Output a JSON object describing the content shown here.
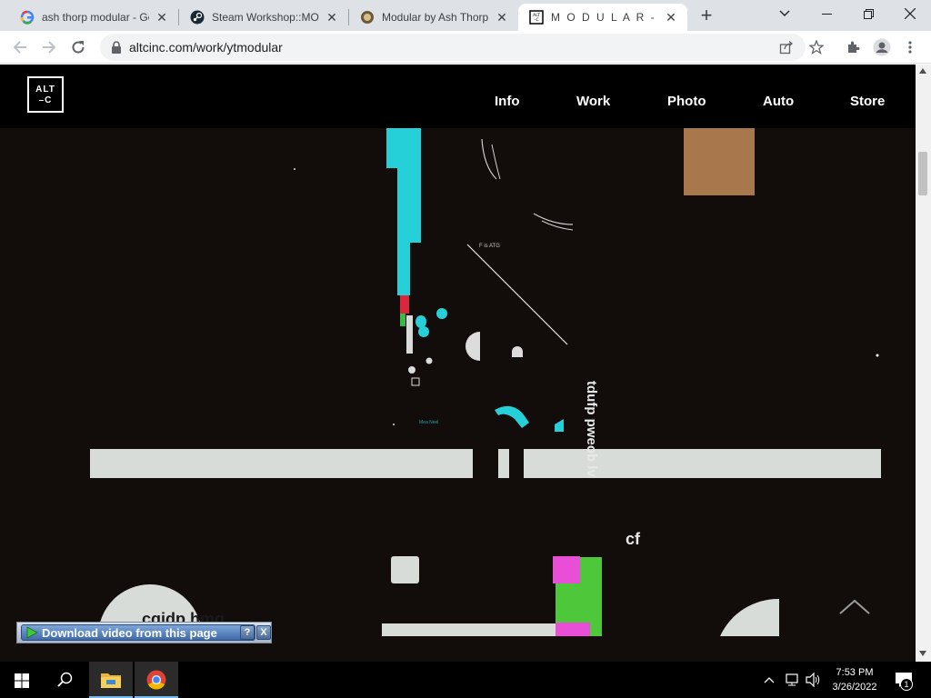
{
  "browser": {
    "tabs": [
      {
        "title": "ash thorp modular - Go",
        "icon": "google-icon"
      },
      {
        "title": "Steam Workshop::MOD",
        "icon": "steam-icon"
      },
      {
        "title": "Modular by Ash Thorp",
        "icon": "modular-favicon"
      },
      {
        "title": "M O D U L A R - Ash Th",
        "icon": "altc-favicon"
      }
    ],
    "new_tab_symbol": "+",
    "url": "altcinc.com/work/ytmodular"
  },
  "site": {
    "logo_line1": "ALT",
    "logo_line2": "–C",
    "nav": [
      "Info",
      "Work",
      "Photo",
      "Auto",
      "Store"
    ]
  },
  "artwork": {
    "vertical_text": "tdufp pweob lv",
    "text_cf": "cf",
    "text_bottom": "cqidp hmq",
    "tiny_label_1": "F is ATG",
    "tiny_label_2": "Mea Neel"
  },
  "download_bar": {
    "label": "Download video from this page",
    "help": "?",
    "close": "X"
  },
  "taskbar": {
    "time": "7:53 PM",
    "date": "3/26/2022",
    "notification_count": "1"
  },
  "colors": {
    "page_bg": "#120c0b",
    "cyan": "#26d0d8",
    "magenta": "#e84fd6",
    "green": "#4ec73a",
    "tan": "#a8774c",
    "light_bar": "#d8dcd8"
  }
}
